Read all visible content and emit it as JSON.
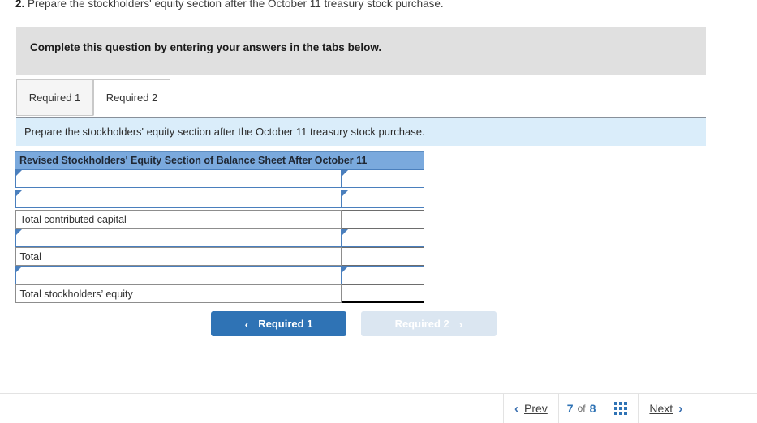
{
  "question": {
    "number": "2.",
    "text": "Prepare the stockholders' equity section after the October 11 treasury stock purchase."
  },
  "instruction_banner": {
    "text": "Complete this question by entering your answers in the tabs below."
  },
  "tabs": [
    {
      "label": "Required 1",
      "active": false
    },
    {
      "label": "Required 2",
      "active": true
    }
  ],
  "sub_instruction": {
    "text": "Prepare the stockholders' equity section after the October 11 treasury stock purchase."
  },
  "worksheet": {
    "title": "Revised Stockholders' Equity Section of Balance Sheet After October 11",
    "rows": [
      {
        "type": "input",
        "label": "",
        "value": ""
      },
      {
        "type": "input",
        "label": "",
        "value": ""
      },
      {
        "type": "subtotal",
        "label": "Total contributed capital",
        "value": ""
      },
      {
        "type": "input",
        "label": "",
        "value": ""
      },
      {
        "type": "subtotal",
        "label": "Total",
        "value": ""
      },
      {
        "type": "input",
        "label": "",
        "value": ""
      },
      {
        "type": "total",
        "label": "Total stockholders’ equity",
        "value": ""
      }
    ]
  },
  "required_nav": {
    "prev_label": "Required 1",
    "prev_chevron": "‹",
    "next_label": "Required 2",
    "next_chevron": "›"
  },
  "pager": {
    "prev_label": "Prev",
    "prev_chevron": "‹",
    "current_page": "7",
    "of_word": "of",
    "total_pages": "8",
    "grid_icon": "grid-3x3-icon",
    "next_label": "Next",
    "next_chevron": "›"
  },
  "colors": {
    "banner_gray": "#e0e0e0",
    "sub_instruction_blue": "#daedfa",
    "table_header_blue": "#7aa9dd",
    "input_border_blue": "#4a7fbd",
    "primary_button_blue": "#2f73b5",
    "disabled_button_blue": "#dbe6f1",
    "link_blue": "#3a6fb0"
  }
}
